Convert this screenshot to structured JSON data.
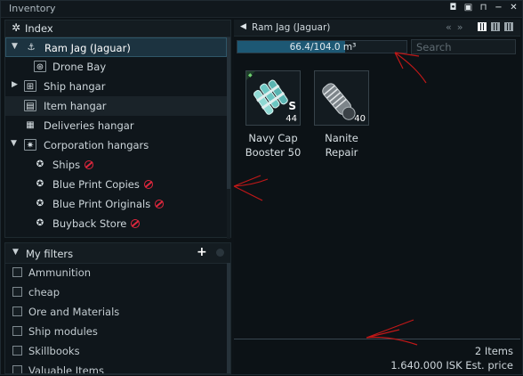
{
  "window": {
    "title": "Inventory"
  },
  "index": {
    "label": "Index"
  },
  "tree": [
    {
      "label": "Ram Jag (Jaguar)",
      "icon": "ship-icon",
      "selected": true
    },
    {
      "label": "Drone Bay",
      "icon": "drone-bay-icon"
    },
    {
      "label": "Ship hangar",
      "icon": "ship-hangar-icon"
    },
    {
      "label": "Item hangar",
      "icon": "item-hangar-icon",
      "highlighted": true
    },
    {
      "label": "Deliveries hangar",
      "icon": "deliveries-icon"
    },
    {
      "label": "Corporation hangars",
      "icon": "corp-hangar-icon"
    },
    {
      "label": "Ships",
      "icon": "corp-division-icon",
      "restricted": true
    },
    {
      "label": "Blue Print Copies",
      "icon": "corp-division-icon",
      "restricted": true
    },
    {
      "label": "Blue Print Originals",
      "icon": "corp-division-icon",
      "restricted": true
    },
    {
      "label": "Buyback Store",
      "icon": "corp-division-icon",
      "restricted": true
    }
  ],
  "filters": {
    "label": "My filters",
    "items": [
      "Ammunition",
      "cheap",
      "Ore and Materials",
      "Ship modules",
      "Skillbooks",
      "Valuable Items"
    ]
  },
  "container": {
    "title": "Ram Jag (Jaguar)",
    "capacity_text": "66.4/104.0 m³",
    "capacity_fraction": 0.638,
    "search_placeholder": "Search"
  },
  "items": [
    {
      "name": "Navy Cap Booster 50",
      "name_line1": "Navy Cap",
      "name_line2": "Booster 50",
      "quantity": "44",
      "size_label": "S",
      "icon": "cap-booster-icon"
    },
    {
      "name": "Nanite Repair",
      "name_line1": "Nanite",
      "name_line2": "Repair",
      "quantity": "40",
      "icon": "nanite-paste-icon"
    }
  ],
  "footer": {
    "item_count": "2 Items",
    "est_price": "1.640.000 ISK Est. price"
  },
  "colors": {
    "accent": "#1d5874",
    "restricted": "#e0273d",
    "annotation": "#c01818"
  }
}
